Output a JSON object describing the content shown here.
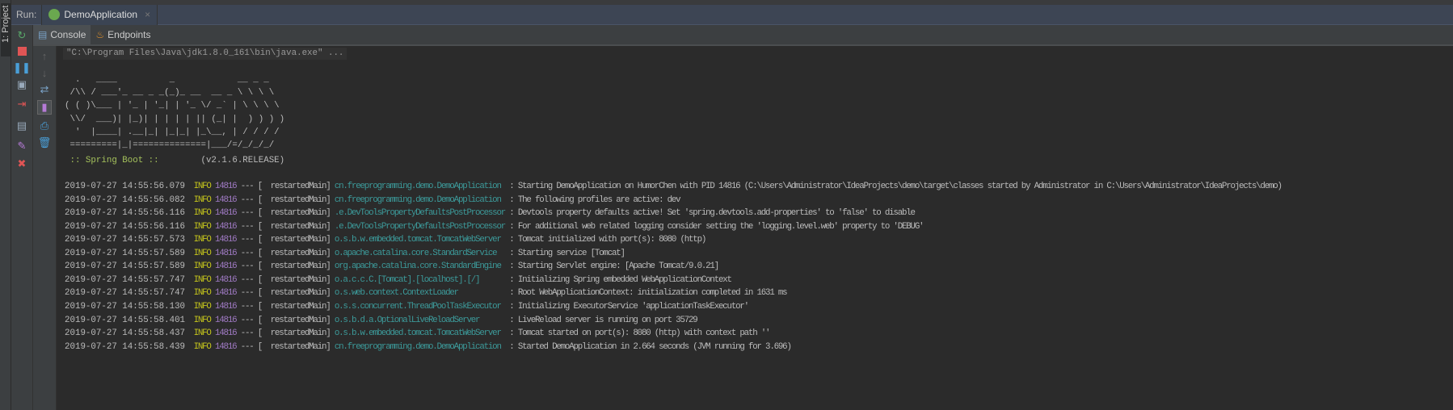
{
  "sidebar": {
    "project_label": "1: Project"
  },
  "run": {
    "label": "Run:",
    "tab": "DemoApplication",
    "close": "×"
  },
  "tabs": [
    {
      "label": "Console"
    },
    {
      "label": "Endpoints"
    }
  ],
  "console": {
    "command": "\"C:\\Program Files\\Java\\jdk1.8.0_161\\bin\\java.exe\" ...",
    "banner": [
      "  .   ____          _            __ _ _",
      " /\\\\ / ___'_ __ _ _(_)_ __  __ _ \\ \\ \\ \\",
      "( ( )\\___ | '_ | '_| | '_ \\/ _` | \\ \\ \\ \\",
      " \\\\/  ___)| |_)| | | | | || (_| |  ) ) ) )",
      "  '  |____| .__|_| |_|_| |_\\__, | / / / /",
      " =========|_|==============|___/=/_/_/_/"
    ],
    "spring_label": " :: Spring Boot :: ",
    "spring_version": "       (v2.1.6.RELEASE)",
    "logs": [
      {
        "ts": "2019-07-27 14:55:56.079",
        "level": "INFO",
        "pid": "14816",
        "thread": "--- [  restartedMain]",
        "logger": "cn.freeprogramming.demo.DemoApplication ",
        "msg": " : Starting DemoApplication on HumorChen with PID 14816 (C:\\Users\\Administrator\\IdeaProjects\\demo\\target\\classes started by Administrator in C:\\Users\\Administrator\\IdeaProjects\\demo)"
      },
      {
        "ts": "2019-07-27 14:55:56.082",
        "level": "INFO",
        "pid": "14816",
        "thread": "--- [  restartedMain]",
        "logger": "cn.freeprogramming.demo.DemoApplication ",
        "msg": " : The following profiles are active: dev"
      },
      {
        "ts": "2019-07-27 14:55:56.116",
        "level": "INFO",
        "pid": "14816",
        "thread": "--- [  restartedMain]",
        "logger": ".e.DevToolsPropertyDefaultsPostProcessor",
        "msg": " : Devtools property defaults active! Set 'spring.devtools.add-properties' to 'false' to disable"
      },
      {
        "ts": "2019-07-27 14:55:56.116",
        "level": "INFO",
        "pid": "14816",
        "thread": "--- [  restartedMain]",
        "logger": ".e.DevToolsPropertyDefaultsPostProcessor",
        "msg": " : For additional web related logging consider setting the 'logging.level.web' property to 'DEBUG'"
      },
      {
        "ts": "2019-07-27 14:55:57.573",
        "level": "INFO",
        "pid": "14816",
        "thread": "--- [  restartedMain]",
        "logger": "o.s.b.w.embedded.tomcat.TomcatWebServer ",
        "msg": " : Tomcat initialized with port(s): 8080 (http)"
      },
      {
        "ts": "2019-07-27 14:55:57.589",
        "level": "INFO",
        "pid": "14816",
        "thread": "--- [  restartedMain]",
        "logger": "o.apache.catalina.core.StandardService  ",
        "msg": " : Starting service [Tomcat]"
      },
      {
        "ts": "2019-07-27 14:55:57.589",
        "level": "INFO",
        "pid": "14816",
        "thread": "--- [  restartedMain]",
        "logger": "org.apache.catalina.core.StandardEngine ",
        "msg": " : Starting Servlet engine: [Apache Tomcat/9.0.21]"
      },
      {
        "ts": "2019-07-27 14:55:57.747",
        "level": "INFO",
        "pid": "14816",
        "thread": "--- [  restartedMain]",
        "logger": "o.a.c.c.C.[Tomcat].[localhost].[/]      ",
        "msg": " : Initializing Spring embedded WebApplicationContext"
      },
      {
        "ts": "2019-07-27 14:55:57.747",
        "level": "INFO",
        "pid": "14816",
        "thread": "--- [  restartedMain]",
        "logger": "o.s.web.context.ContextLoader           ",
        "msg": " : Root WebApplicationContext: initialization completed in 1631 ms"
      },
      {
        "ts": "2019-07-27 14:55:58.130",
        "level": "INFO",
        "pid": "14816",
        "thread": "--- [  restartedMain]",
        "logger": "o.s.s.concurrent.ThreadPoolTaskExecutor ",
        "msg": " : Initializing ExecutorService 'applicationTaskExecutor'"
      },
      {
        "ts": "2019-07-27 14:55:58.401",
        "level": "INFO",
        "pid": "14816",
        "thread": "--- [  restartedMain]",
        "logger": "o.s.b.d.a.OptionalLiveReloadServer      ",
        "msg": " : LiveReload server is running on port 35729"
      },
      {
        "ts": "2019-07-27 14:55:58.437",
        "level": "INFO",
        "pid": "14816",
        "thread": "--- [  restartedMain]",
        "logger": "o.s.b.w.embedded.tomcat.TomcatWebServer ",
        "msg": " : Tomcat started on port(s): 8080 (http) with context path ''"
      },
      {
        "ts": "2019-07-27 14:55:58.439",
        "level": "INFO",
        "pid": "14816",
        "thread": "--- [  restartedMain]",
        "logger": "cn.freeprogramming.demo.DemoApplication ",
        "msg": " : Started DemoApplication in 2.664 seconds (JVM running for 3.696)"
      }
    ]
  }
}
